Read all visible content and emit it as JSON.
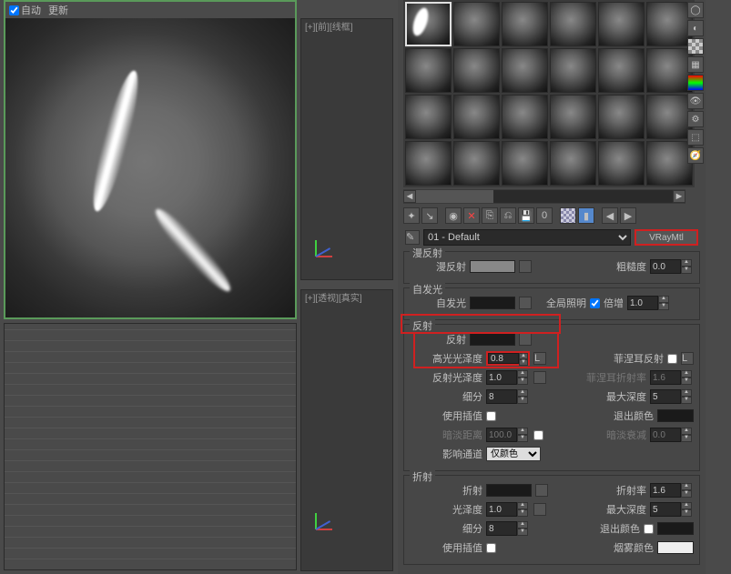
{
  "preview": {
    "auto_label": "自动",
    "update_label": "更新"
  },
  "viewport_top": "[+][前][线框]",
  "viewport_bot": "[+][透视][真实]",
  "material_name": "01 - Default",
  "material_type": "VRayMtl",
  "sections": {
    "diffuse": {
      "title": "漫反射",
      "diffuse_label": "漫反射",
      "rough_label": "粗糙度",
      "rough_val": "0.0"
    },
    "selfillum": {
      "title": "自发光",
      "si_label": "自发光",
      "gi_label": "全局照明",
      "mult_label": "倍增",
      "mult_val": "1.0"
    },
    "reflect": {
      "title": "反射",
      "rf_label": "反射",
      "hilight_label": "高光光泽度",
      "hilight_val": "0.8",
      "L": "L",
      "fresnel_label": "菲涅耳反射",
      "rgloss_label": "反射光泽度",
      "rgloss_val": "1.0",
      "fior_label": "菲涅耳折射率",
      "fior_val": "1.6",
      "subdiv_label": "细分",
      "subdiv_val": "8",
      "maxdepth_label": "最大深度",
      "maxdepth_val": "5",
      "useinterp_label": "使用插值",
      "exitcolor_label": "退出颜色",
      "dimdist_label": "暗淡距离",
      "dimdist_val": "100.0",
      "dimfall_label": "暗淡衰减",
      "dimfall_val": "0.0",
      "affect_label": "影响通道",
      "affect_val": "仅颜色"
    },
    "refract": {
      "title": "折射",
      "rfr_label": "折射",
      "ior_label": "折射率",
      "ior_val": "1.6",
      "gloss_label": "光泽度",
      "gloss_val": "1.0",
      "maxdepth_label": "最大深度",
      "maxdepth_val": "5",
      "subdiv_label": "细分",
      "subdiv_val": "8",
      "exitcolor_label": "退出颜色",
      "useinterp_label": "使用插值",
      "fog_label": "烟雾颜色"
    }
  }
}
